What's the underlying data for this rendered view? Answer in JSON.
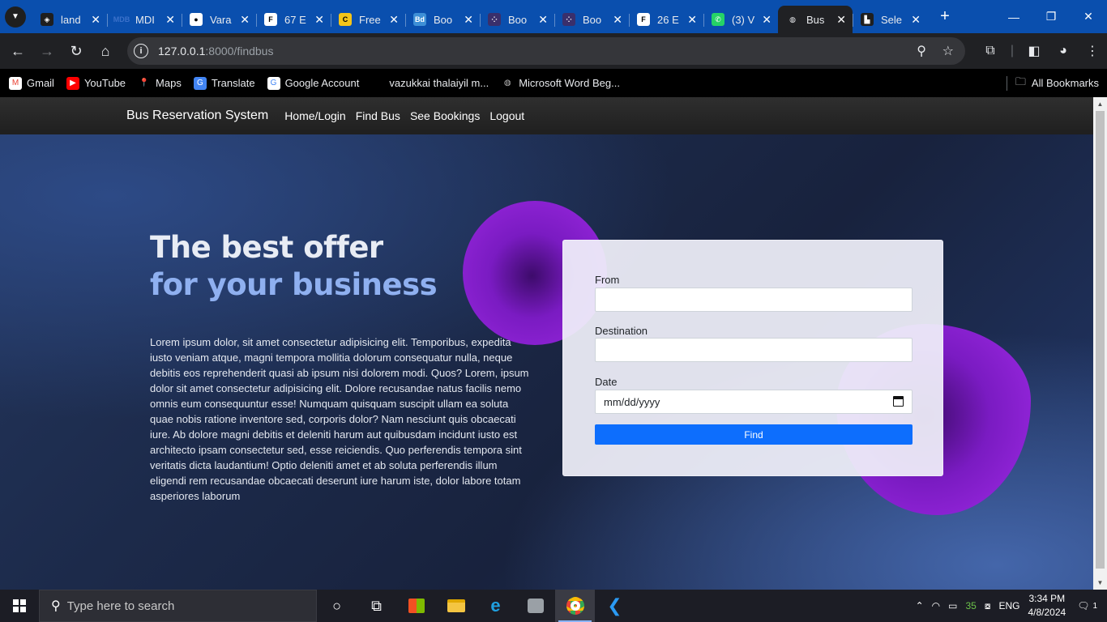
{
  "browser": {
    "tabs": [
      {
        "title": "land",
        "fav": "◈",
        "fav_bg": "#1f1f1f",
        "fav_color": "#fff"
      },
      {
        "title": "MDI",
        "fav": "MDB",
        "fav_bg": "transparent",
        "fav_color": "#3b71ca"
      },
      {
        "title": "Vara",
        "fav": "●",
        "fav_bg": "#fff",
        "fav_color": "#000"
      },
      {
        "title": "67 E",
        "fav": "F",
        "fav_bg": "#fff",
        "fav_color": "#000"
      },
      {
        "title": "Free",
        "fav": "C",
        "fav_bg": "#f5c518",
        "fav_color": "#000"
      },
      {
        "title": "Boo",
        "fav": "Bd",
        "fav_bg": "#3d8fd6",
        "fav_color": "#fff"
      },
      {
        "title": "Boo",
        "fav": "⁘",
        "fav_bg": "#3a2f6b",
        "fav_color": "#fff"
      },
      {
        "title": "Boo",
        "fav": "⁘",
        "fav_bg": "#3a2f6b",
        "fav_color": "#fff"
      },
      {
        "title": "26 E",
        "fav": "F",
        "fav_bg": "#fff",
        "fav_color": "#000"
      },
      {
        "title": "(3) V",
        "fav": "✆",
        "fav_bg": "#25d366",
        "fav_color": "#fff"
      },
      {
        "title": "Bus",
        "fav": "◍",
        "fav_bg": "transparent",
        "fav_color": "#e8eaed",
        "active": true
      },
      {
        "title": "Sele",
        "fav": "▙",
        "fav_bg": "#1f1f1f",
        "fav_color": "#fff"
      }
    ],
    "close_glyph": "✕",
    "new_tab_glyph": "+",
    "url_host": "127.0.0.1",
    "url_path": ":8000/findbus",
    "bookmarks": [
      {
        "label": "Gmail",
        "icon": "M",
        "bg": "#fff",
        "color": "#ea4335"
      },
      {
        "label": "YouTube",
        "icon": "▶",
        "bg": "#ff0000",
        "color": "#fff"
      },
      {
        "label": "Maps",
        "icon": "📍",
        "bg": "transparent",
        "color": "#34a853"
      },
      {
        "label": "Translate",
        "icon": "G",
        "bg": "#4285f4",
        "color": "#fff"
      },
      {
        "label": "Google Account",
        "icon": "G",
        "bg": "#fff",
        "color": "#4285f4"
      },
      {
        "label": "vazukkai thalaiyil m...",
        "icon": "",
        "bg": "transparent",
        "color": "#fff"
      },
      {
        "label": "Microsoft Word Beg...",
        "icon": "◍",
        "bg": "transparent",
        "color": "#bbb"
      }
    ],
    "all_bookmarks": "All Bookmarks"
  },
  "site": {
    "brand": "Bus Reservation System",
    "nav": [
      "Home/Login",
      "Find Bus",
      "See Bookings",
      "Logout"
    ],
    "hero_line1": "The best offer",
    "hero_line2": "for your business",
    "hero_text": "Lorem ipsum dolor, sit amet consectetur adipisicing elit. Temporibus, expedita iusto veniam atque, magni tempora mollitia dolorum consequatur nulla, neque debitis eos reprehenderit quasi ab ipsum nisi dolorem modi. Quos? Lorem, ipsum dolor sit amet consectetur adipisicing elit. Dolore recusandae natus facilis nemo omnis eum consequuntur esse! Numquam quisquam suscipit ullam ea soluta quae nobis ratione inventore sed, corporis dolor? Nam nesciunt quis obcaecati iure. Ab dolore magni debitis et deleniti harum aut quibusdam incidunt iusto est architecto ipsam consectetur sed, esse reiciendis. Quo perferendis tempora sint veritatis dicta laudantium! Optio deleniti amet et ab soluta perferendis illum eligendi rem recusandae obcaecati deserunt iure harum iste, dolor labore totam asperiores laborum",
    "form": {
      "from_label": "From",
      "from_value": "",
      "destination_label": "Destination",
      "destination_value": "",
      "date_label": "Date",
      "date_placeholder": "mm/dd/yyyy",
      "find_label": "Find"
    }
  },
  "taskbar": {
    "search_placeholder": "Type here to search",
    "language": "ENG",
    "time": "3:34 PM",
    "date": "4/8/2024",
    "battery_text": "35",
    "notification_count": "1"
  }
}
